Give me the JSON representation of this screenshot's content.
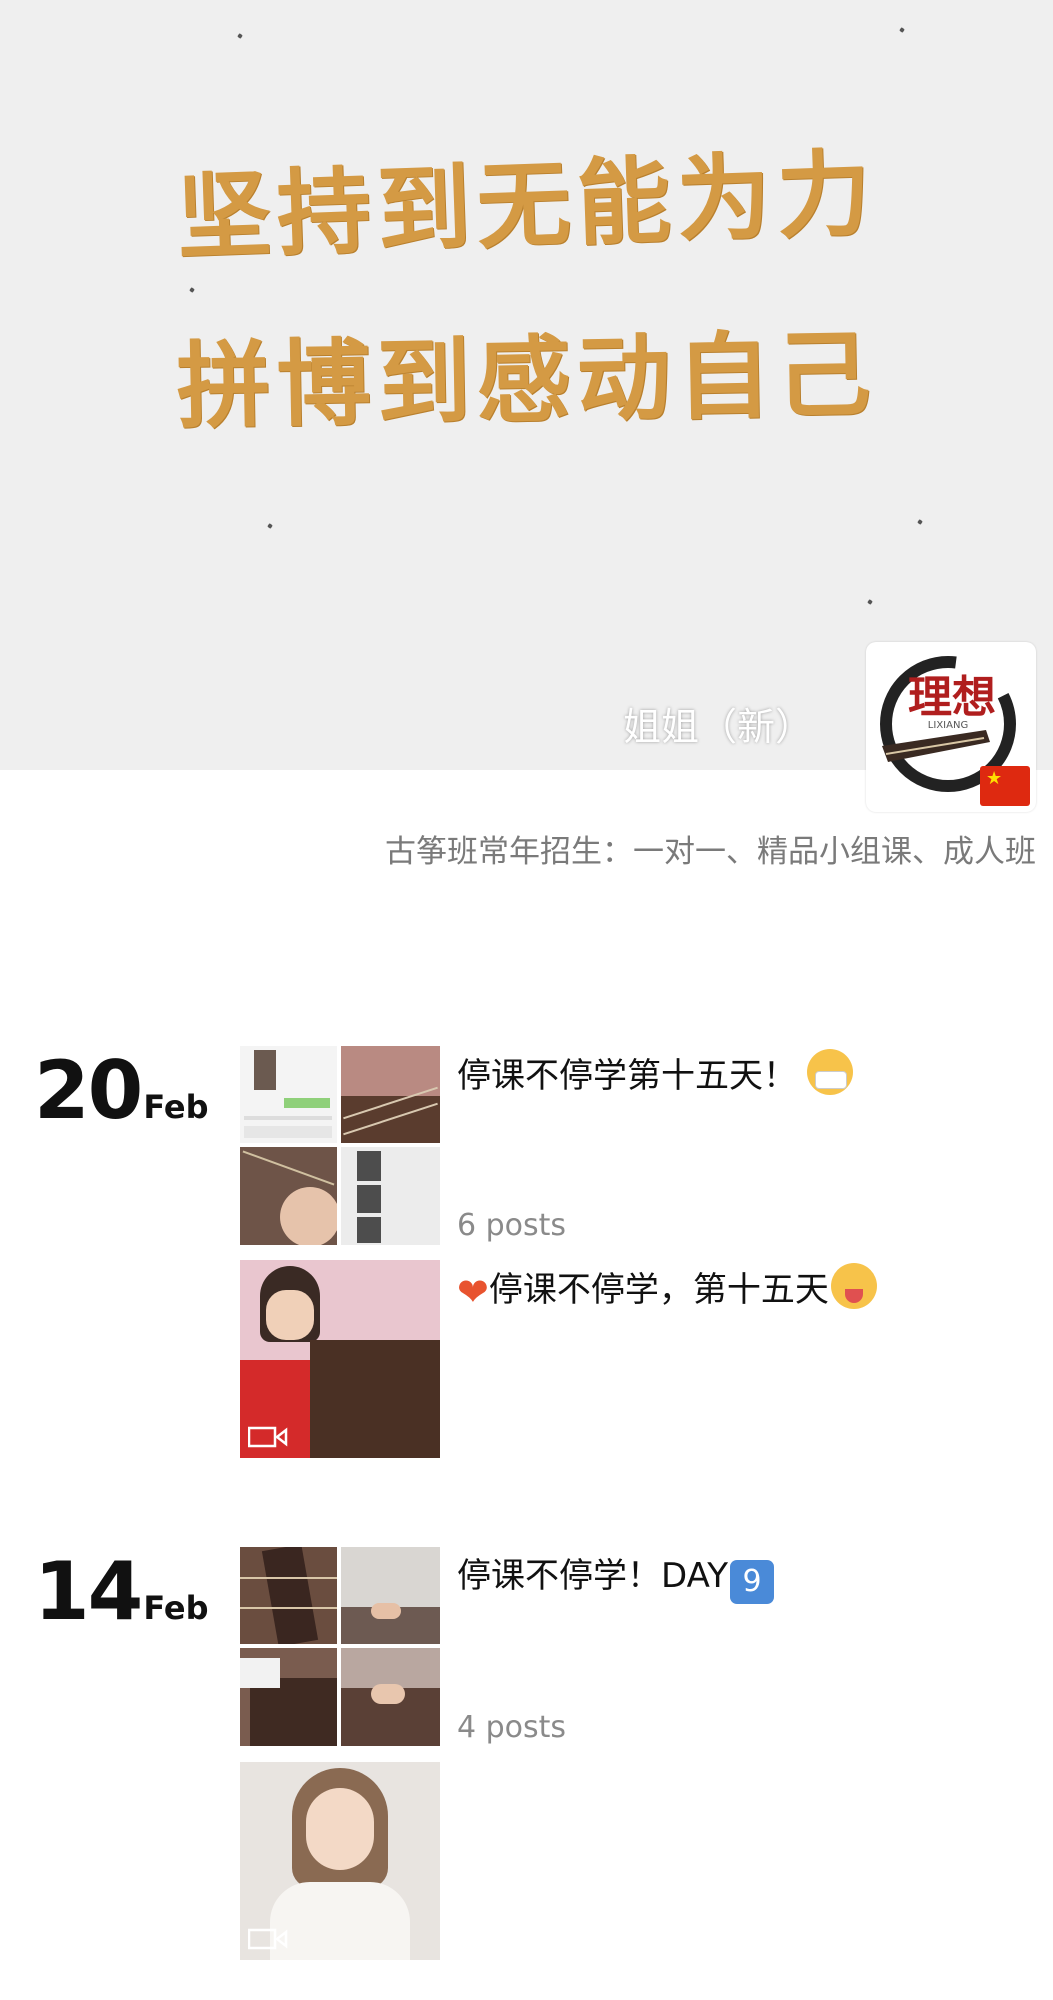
{
  "cover": {
    "slogan_line1": "坚持到无能为力",
    "slogan_line2": "拼博到感动自己",
    "accent_color": "#d49a44"
  },
  "profile": {
    "name": "姐姐（新）",
    "avatar_text": "理想",
    "avatar_subtext": "LIXIANG",
    "flag_icon": "china-flag-icon",
    "signature": "古筝班常年招生：一对一、精品小组课、成人班"
  },
  "entries": [
    {
      "day": "20",
      "month": "Feb",
      "posts": [
        {
          "title": "停课不停学第十五天！",
          "emoji": "mask-face-emoji",
          "count": "6 posts",
          "kind": "grid"
        },
        {
          "title": "停课不停学，第十五天",
          "leading_emoji": "❤",
          "emoji": "hot-face-emoji",
          "kind": "video"
        }
      ]
    },
    {
      "day": "14",
      "month": "Feb",
      "posts": [
        {
          "title": "停课不停学！DAY",
          "keycap": "9",
          "count": "4 posts",
          "kind": "grid"
        },
        {
          "title": "",
          "kind": "video"
        }
      ]
    }
  ]
}
